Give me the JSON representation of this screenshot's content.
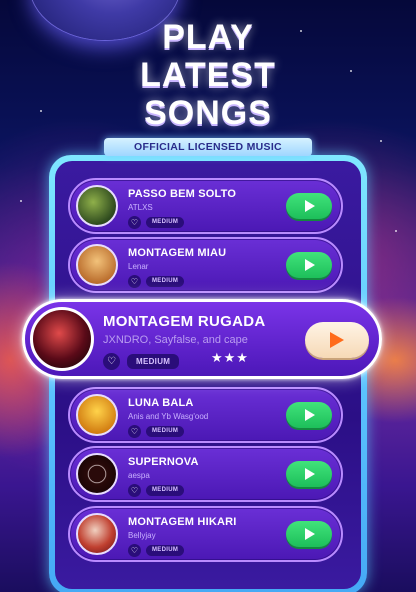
{
  "headline": [
    "PLAY",
    "LATEST",
    "SONGS"
  ],
  "ribbon": "OFFICIAL LICENSED MUSIC",
  "songs": [
    {
      "title": "PASSO BEM SOLTO",
      "artist": "ATLXS",
      "difficulty": "MEDIUM",
      "cover_color": "#3d5a2a"
    },
    {
      "title": "MONTAGEM MIAU",
      "artist": "Lenar",
      "difficulty": "MEDIUM",
      "cover_color": "#e0a05a"
    },
    {
      "title": "MONTAGEM RUGADA",
      "artist": "JXNDRO, Sayfalse, and cape",
      "difficulty": "MEDIUM",
      "stars": "★★★",
      "cover_color": "#8a1a2a"
    },
    {
      "title": "LUNA BALA",
      "artist": "Anis and Yb Wasg'ood",
      "difficulty": "MEDIUM",
      "cover_color": "#f0b020"
    },
    {
      "title": "SUPERNOVA",
      "artist": "aespa",
      "difficulty": "MEDIUM",
      "cover_color": "#3a0d0d"
    },
    {
      "title": "MONTAGEM HIKARI",
      "artist": "Bellyjay",
      "difficulty": "MEDIUM",
      "cover_color": "#c0403a"
    }
  ],
  "colors": {
    "play_green": "#2ad06a",
    "featured_play_icon": "#ff6b1a",
    "ribbon": "#bfe6ff"
  },
  "icons": {
    "heart": "heart-icon",
    "play": "play-icon",
    "star": "star-icon"
  }
}
